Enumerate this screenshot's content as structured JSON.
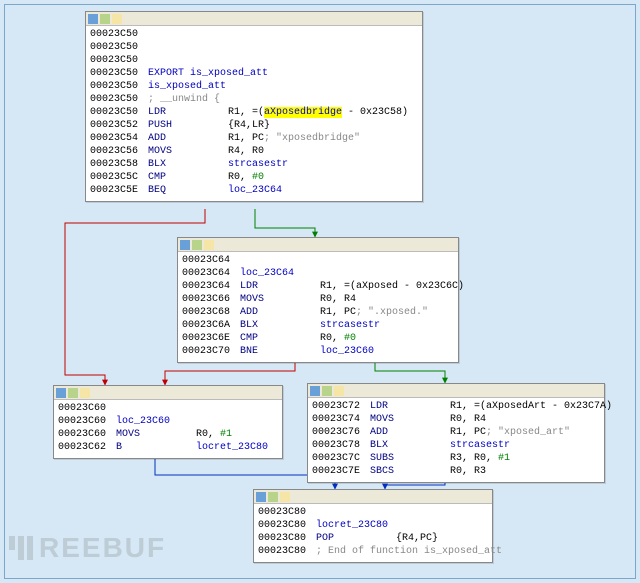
{
  "watermark": "REEBUF",
  "nodes": [
    {
      "id": "n1",
      "lines": [
        {
          "addr": "00023C50",
          "mn": "",
          "op": ""
        },
        {
          "addr": "00023C50",
          "mn": "",
          "op": ""
        },
        {
          "addr": "00023C50",
          "mn": "",
          "op": ""
        },
        {
          "addr": "00023C50",
          "export": "EXPORT is_xposed_att"
        },
        {
          "addr": "00023C50",
          "funcname": "is_xposed_att"
        },
        {
          "addr": "00023C50",
          "cmt_full": "; __unwind {"
        },
        {
          "addr": "00023C50",
          "mn": "LDR",
          "op_parts": [
            "R1, =(",
            {
              "hl": "aXposedbridge"
            },
            " - 0x23C58)"
          ]
        },
        {
          "addr": "00023C52",
          "mn": "PUSH",
          "op": "{R4,LR}"
        },
        {
          "addr": "00023C54",
          "mn": "ADD",
          "op": "R1, PC",
          "cmt": "; \"xposedbridge\""
        },
        {
          "addr": "00023C56",
          "mn": "MOVS",
          "op": "R4, R0"
        },
        {
          "addr": "00023C58",
          "mn": "BLX",
          "op_sym": "strcasestr"
        },
        {
          "addr": "00023C5C",
          "mn": "CMP",
          "op": "R0, ",
          "num": "#0"
        },
        {
          "addr": "00023C5E",
          "mn": "BEQ",
          "op_sym": "loc_23C64"
        }
      ]
    },
    {
      "id": "n2",
      "lines": [
        {
          "addr": "00023C64",
          "mn": "",
          "op": ""
        },
        {
          "addr": "00023C64",
          "loc": "loc_23C64"
        },
        {
          "addr": "00023C64",
          "mn": "LDR",
          "op": "R1, =(aXposed - 0x23C6C)"
        },
        {
          "addr": "00023C66",
          "mn": "MOVS",
          "op": "R0, R4"
        },
        {
          "addr": "00023C68",
          "mn": "ADD",
          "op": "R1, PC",
          "cmt": "; \".xposed.\""
        },
        {
          "addr": "00023C6A",
          "mn": "BLX",
          "op_sym": "strcasestr"
        },
        {
          "addr": "00023C6E",
          "mn": "CMP",
          "op": "R0, ",
          "num": "#0"
        },
        {
          "addr": "00023C70",
          "mn": "BNE",
          "op_sym": "loc_23C60"
        }
      ]
    },
    {
      "id": "n3",
      "lines": [
        {
          "addr": "00023C60",
          "mn": "",
          "op": ""
        },
        {
          "addr": "00023C60",
          "loc": "loc_23C60"
        },
        {
          "addr": "00023C60",
          "mn": "MOVS",
          "op": "R0, ",
          "num": "#1"
        },
        {
          "addr": "00023C62",
          "mn": "B",
          "op_sym": "locret_23C80"
        }
      ]
    },
    {
      "id": "n4",
      "lines": [
        {
          "addr": "00023C72",
          "mn": "LDR",
          "op": "R1, =(aXposedArt - 0x23C7A)"
        },
        {
          "addr": "00023C74",
          "mn": "MOVS",
          "op": "R0, R4"
        },
        {
          "addr": "00023C76",
          "mn": "ADD",
          "op": "R1, PC",
          "cmt": "; \"xposed_art\""
        },
        {
          "addr": "00023C78",
          "mn": "BLX",
          "op_sym": "strcasestr"
        },
        {
          "addr": "00023C7C",
          "mn": "SUBS",
          "op": "R3, R0, ",
          "num": "#1"
        },
        {
          "addr": "00023C7E",
          "mn": "SBCS",
          "op": "R0, R3"
        }
      ]
    },
    {
      "id": "n5",
      "lines": [
        {
          "addr": "00023C80",
          "mn": "",
          "op": ""
        },
        {
          "addr": "00023C80",
          "loc": "locret_23C80"
        },
        {
          "addr": "00023C80",
          "mn": "POP",
          "op": "{R4,PC}"
        },
        {
          "addr": "00023C80",
          "cmt_full": "; End of function is_xposed_att"
        }
      ]
    }
  ]
}
